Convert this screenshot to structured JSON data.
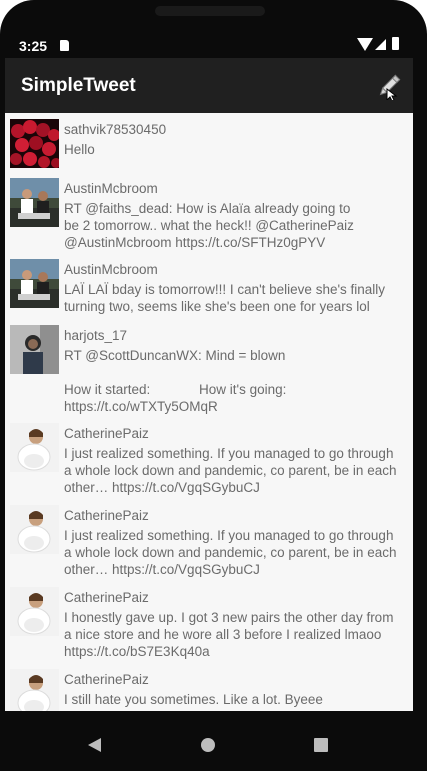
{
  "status_bar": {
    "time": "3:25"
  },
  "app": {
    "title": "SimpleTweet",
    "compose_icon": "pencil-icon"
  },
  "tweets": [
    {
      "user": "sathvik78530450",
      "text": "Hello"
    },
    {
      "user": "AustinMcbroom",
      "text": "RT @faiths_dead: How is Alaïa already going to\nbe 2 tomorrow.. what the heck!! @CatherinePaiz\n@AustinMcbroom https://t.co/SFTHz0gPYV"
    },
    {
      "user": "AustinMcbroom",
      "text": "LAÏ LAÏ bday is tomorrow!!! I can't believe she's finally\nturning two, seems like she's been one for years lol"
    },
    {
      "user": "harjots_17",
      "text": "RT @ScottDuncanWX: Mind = blown\n\nHow it started:             How it's going:\nhttps://t.co/wTXTy5OMqR"
    },
    {
      "user": "CatherinePaiz",
      "text": "I just realized something. If you managed to go through\na whole lock down and pandemic, co parent, be in each\nother… https://t.co/VgqSGybuCJ"
    },
    {
      "user": "CatherinePaiz",
      "text": "I just realized something. If you managed to go through\na whole lock down and pandemic, co parent, be in each\nother… https://t.co/VgqSGybuCJ"
    },
    {
      "user": "CatherinePaiz",
      "text": "I honestly gave up. I got 3 new pairs the other day from\na nice store and he wore all 3 before I realized lmaoo\nhttps://t.co/bS7E3Kq40a"
    },
    {
      "user": "CatherinePaiz",
      "text": "I still hate you sometimes. Like a lot. Byeee"
    }
  ],
  "colors": {
    "toolbar": "#202020",
    "list_bg": "#f7f7f7",
    "text": "#6b6b6b"
  }
}
